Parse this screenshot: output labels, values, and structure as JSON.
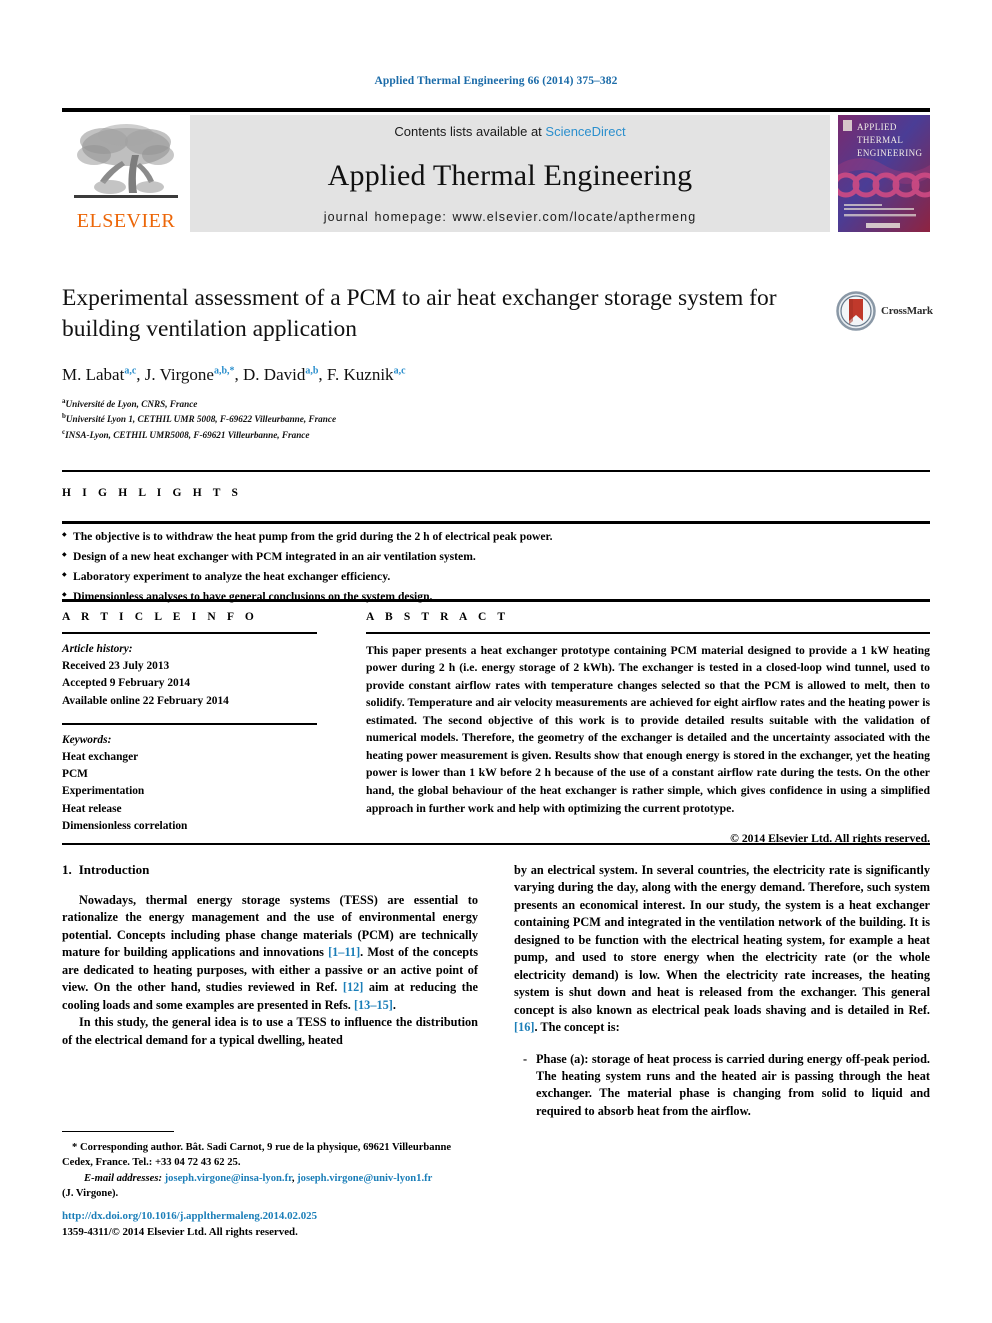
{
  "running_head": "Applied Thermal Engineering 66 (2014) 375–382",
  "masthead": {
    "contents_prefix": "Contents lists available at ",
    "sciencedirect": "ScienceDirect",
    "journal_title": "Applied Thermal Engineering",
    "homepage": "journal homepage: www.elsevier.com/locate/apthermeng",
    "publisher": "ELSEVIER",
    "cover_line1": "APPLIED",
    "cover_line2": "THERMAL",
    "cover_line3": "ENGINEERING"
  },
  "article": {
    "title": "Experimental assessment of a PCM to air heat exchanger storage system for building ventilation application",
    "authors_html": "M. Labat<sup>a,c</sup>, J. Virgone<sup>a,b,</sup><sup>*</sup>, D. David<sup>a,b</sup>, F. Kuznik<sup>a,c</sup>",
    "affiliations": [
      "Université de Lyon, CNRS, France",
      "Université Lyon 1, CETHIL UMR 5008, F-69622 Villeurbanne, France",
      "INSA-Lyon, CETHIL UMR5008, F-69621 Villeurbanne, France"
    ],
    "affil_marks": [
      "a",
      "b",
      "c"
    ],
    "crossmark_label": "CrossMark"
  },
  "highlights": {
    "label": "H I G H L I G H T S",
    "items": [
      "The objective is to withdraw the heat pump from the grid during the 2 h of electrical peak power.",
      "Design of a new heat exchanger with PCM integrated in an air ventilation system.",
      "Laboratory experiment to analyze the heat exchanger efficiency.",
      "Dimensionless analyses to have general conclusions on the system design."
    ]
  },
  "article_info": {
    "label": "A R T I C L E   I N F O",
    "history_label": "Article history:",
    "history": [
      "Received 23 July 2013",
      "Accepted 9 February 2014",
      "Available online 22 February 2014"
    ],
    "keywords_label": "Keywords:",
    "keywords": [
      "Heat exchanger",
      "PCM",
      "Experimentation",
      "Heat release",
      "Dimensionless correlation"
    ]
  },
  "abstract": {
    "label": "A B S T R A C T",
    "text": "This paper presents a heat exchanger prototype containing PCM material designed to provide a 1 kW heating power during 2 h (i.e. energy storage of 2 kWh). The exchanger is tested in a closed-loop wind tunnel, used to provide constant airflow rates with temperature changes selected so that the PCM is allowed to melt, then to solidify. Temperature and air velocity measurements are achieved for eight airflow rates and the heating power is estimated. The second objective of this work is to provide detailed results suitable with the validation of numerical models. Therefore, the geometry of the exchanger is detailed and the uncertainty associated with the heating power measurement is given. Results show that enough energy is stored in the exchanger, yet the heating power is lower than 1 kW before 2 h because of the use of a constant airflow rate during the tests. On the other hand, the global behaviour of the heat exchanger is rather simple, which gives confidence in using a simplified approach in further work and help with optimizing the current prototype.",
    "copyright": "© 2014 Elsevier Ltd. All rights reserved."
  },
  "introduction": {
    "number": "1.",
    "heading": "Introduction",
    "para1_html": "Nowadays, thermal energy storage systems (TESS) are essential to rationalize the energy management and the use of environmental energy potential. Concepts including phase change materials (PCM) are technically mature for building applications and innovations <a class=\"ref\" href=\"#\" data-name=\"citation-link\" data-interactable=\"true\">[1–11]</a>. Most of the concepts are dedicated to heating purposes, with either a passive or an active point of view. On the other hand, studies reviewed in Ref. <a class=\"ref\" href=\"#\" data-name=\"citation-link\" data-interactable=\"true\">[12]</a> aim at reducing the cooling loads and some examples are presented in Refs. <a class=\"ref\" href=\"#\" data-name=\"citation-link\" data-interactable=\"true\">[13–15]</a>.",
    "para2_html": "In this study, the general idea is to use a TESS to influence the distribution of the electrical demand for a typical dwelling, heated",
    "para3_html": "by an electrical system. In several countries, the electricity rate is significantly varying during the day, along with the energy demand. Therefore, such system presents an economical interest. In our study, the system is a heat exchanger containing PCM and integrated in the ventilation network of the building. It is designed to be function with the electrical heating system, for example a heat pump, and used to store energy when the electricity rate (or the whole electricity demand) is low. When the electricity rate increases, the heating system is shut down and heat is released from the exchanger. This general concept is also known as electrical peak loads shaving and is detailed in Ref. <a class=\"ref\" href=\"#\" data-name=\"citation-link\" data-interactable=\"true\">[16]</a>. The concept is:",
    "bullet1": "Phase (a): storage of heat process is carried during energy off-peak period. The heating system runs and the heated air is passing through the heat exchanger. The material phase is changing from solid to liquid and required to absorb heat from the airflow."
  },
  "footnote": {
    "corresponding_html": "* Corresponding author. Bât. Sadi Carnot, 9 rue de la physique, 69621 Villeurbanne Cedex, France. Tel.: +33 04 72 43 62 25.",
    "email_label": "E-mail addresses:",
    "email1": "joseph.virgone@insa-lyon.fr",
    "email2": "joseph.virgone@univ-lyon1.fr",
    "email_attrib": "(J. Virgone)."
  },
  "doi_block": {
    "doi_url": "http://dx.doi.org/10.1016/j.applthermaleng.2014.02.025",
    "issn_line": "1359-4311/© 2014 Elsevier Ltd. All rights reserved."
  },
  "colors": {
    "link_blue": "#1b7eb8",
    "running_head_blue": "#1b6ba8",
    "elsevier_orange": "#ec6608",
    "banner_gray": "#e3e3e3"
  }
}
